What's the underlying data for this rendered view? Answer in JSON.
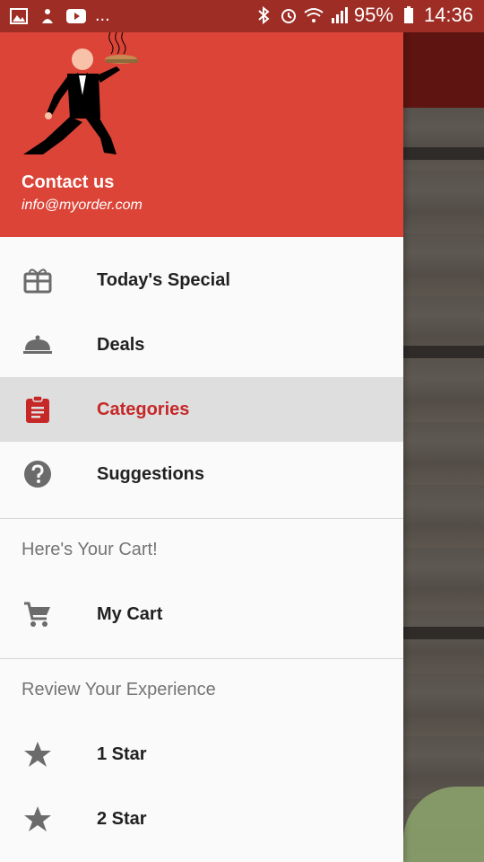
{
  "status_bar": {
    "more": "...",
    "battery": "95%",
    "time": "14:36"
  },
  "drawer": {
    "header": {
      "title": "Contact us",
      "email": "info@myorder.com"
    },
    "main_items": [
      {
        "label": "Today's Special",
        "icon": "gift-icon"
      },
      {
        "label": "Deals",
        "icon": "cloche-icon"
      },
      {
        "label": "Categories",
        "icon": "clipboard-icon",
        "selected": true
      },
      {
        "label": "Suggestions",
        "icon": "help-icon"
      }
    ],
    "cart_section": {
      "header": "Here's Your Cart!",
      "items": [
        {
          "label": "My Cart",
          "icon": "cart-icon"
        }
      ]
    },
    "review_section": {
      "header": "Review Your Experience",
      "items": [
        {
          "label": "1 Star",
          "icon": "star-icon"
        },
        {
          "label": "2 Star",
          "icon": "star-icon"
        }
      ]
    }
  },
  "colors": {
    "accent": "#db4437",
    "selected_text": "#c62828",
    "status_bar": "#9e2d25"
  }
}
